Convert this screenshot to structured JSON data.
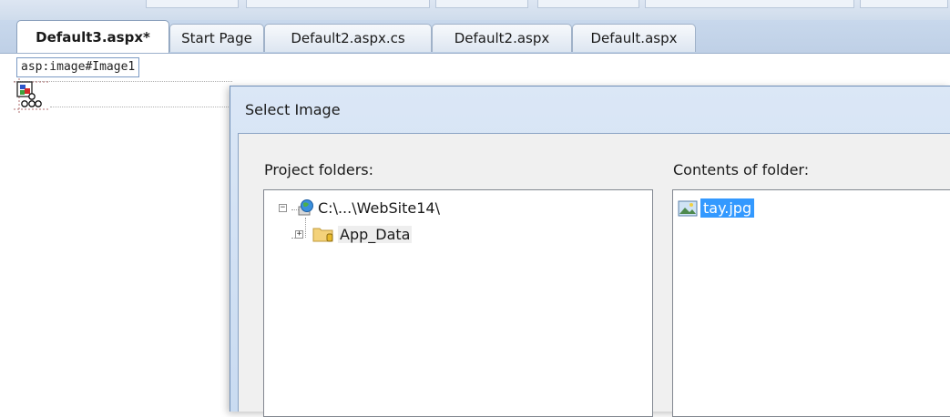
{
  "tabs": [
    {
      "label": "Default3.aspx*",
      "active": true
    },
    {
      "label": "Start Page",
      "active": false
    },
    {
      "label": "Default2.aspx.cs",
      "active": false
    },
    {
      "label": "Default2.aspx",
      "active": false
    },
    {
      "label": "Default.aspx",
      "active": false
    }
  ],
  "designer": {
    "element_tag": "asp:image#Image1",
    "selected_control_icon": "image-control-icon"
  },
  "dialog": {
    "title": "Select Image",
    "project_folders_label": "Project folders:",
    "contents_label": "Contents of folder:",
    "tree": [
      {
        "label": "C:\\...\\WebSite14\\",
        "icon": "website-globe-icon",
        "expander": "−",
        "level": 0
      },
      {
        "label": "App_Data",
        "icon": "data-folder-icon",
        "expander": "+",
        "level": 1
      }
    ],
    "files": [
      {
        "label": "tay.jpg",
        "icon": "image-file-icon",
        "selected": true
      }
    ]
  },
  "colors": {
    "selection": "#3399ff",
    "dialog_title_bar": "#c9dbf1"
  }
}
